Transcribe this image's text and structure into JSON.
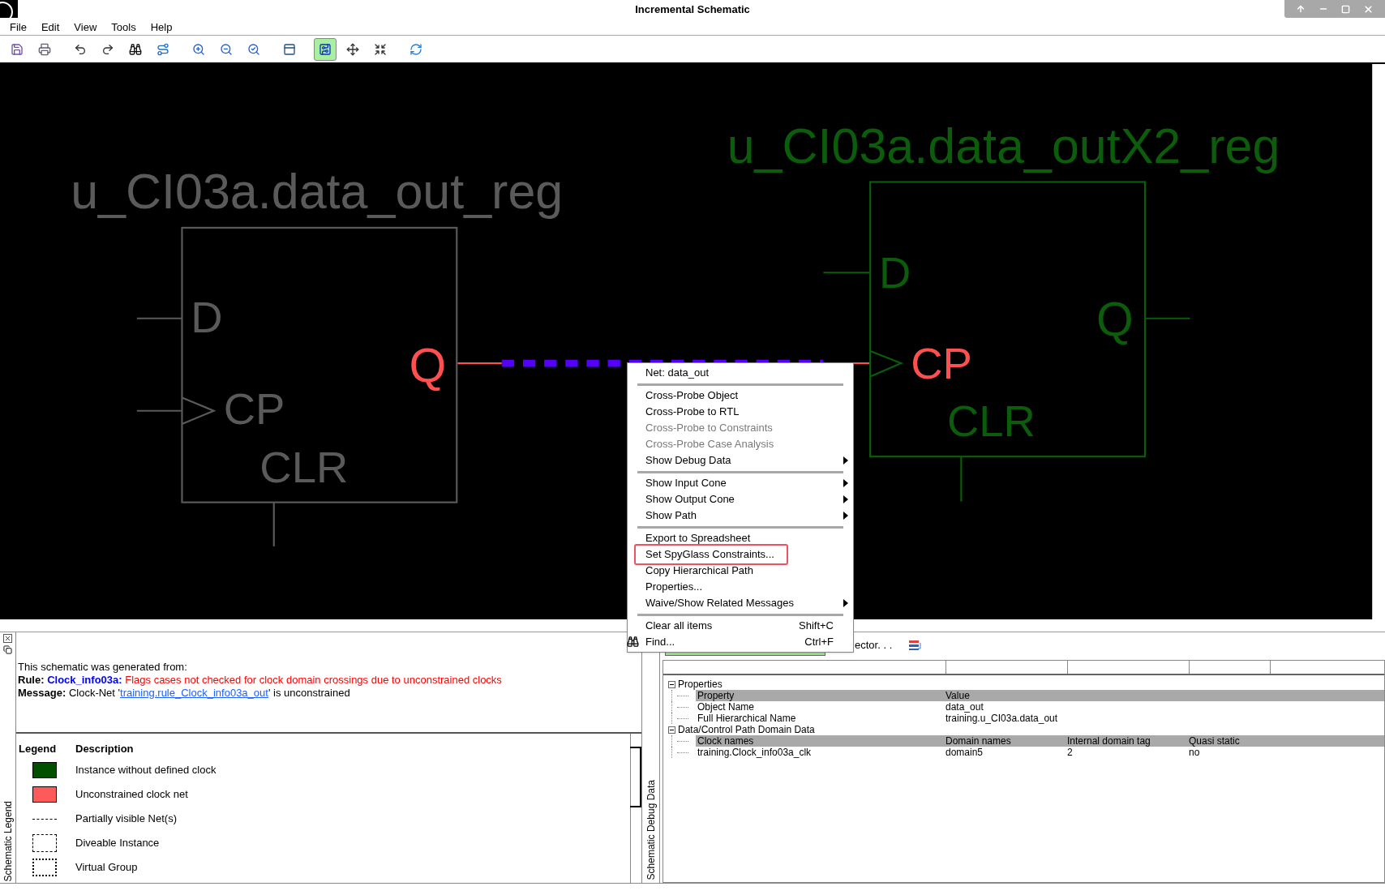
{
  "window": {
    "title": "Incremental Schematic"
  },
  "menu_bar": [
    {
      "label": "File"
    },
    {
      "label": "Edit"
    },
    {
      "label": "View"
    },
    {
      "label": "Tools"
    },
    {
      "label": "Help"
    }
  ],
  "toolbar": [
    {
      "buttons": [
        {
          "kind": "save",
          "selected": false
        },
        {
          "kind": "print",
          "selected": false
        }
      ]
    },
    {
      "buttons": [
        {
          "kind": "undo",
          "selected": false
        },
        {
          "kind": "redo",
          "selected": false
        },
        {
          "kind": "find",
          "selected": false
        },
        {
          "kind": "route",
          "selected": false
        }
      ]
    },
    {
      "buttons": [
        {
          "kind": "zoom-in",
          "selected": false
        },
        {
          "kind": "zoom-out",
          "selected": false
        },
        {
          "kind": "zoom-fit",
          "selected": false
        }
      ]
    },
    {
      "buttons": [
        {
          "kind": "panel",
          "selected": false
        }
      ]
    },
    {
      "buttons": [
        {
          "kind": "circuit",
          "selected": true
        },
        {
          "kind": "expand",
          "selected": false
        },
        {
          "kind": "contract",
          "selected": false
        }
      ]
    },
    {
      "buttons": [
        {
          "kind": "refresh",
          "selected": false
        }
      ]
    }
  ],
  "schematic": {
    "instances": [
      {
        "name": "u_CI03a.data_out_reg",
        "color": "#5a5a5a",
        "pins": [
          {
            "label": "D",
            "color": "#5a5a5a"
          },
          {
            "label": "CP",
            "color": "#5a5a5a"
          },
          {
            "label": "CLR",
            "color": "#5a5a5a"
          },
          {
            "label": "Q",
            "color": "#ff5050"
          }
        ]
      },
      {
        "name": "u_CI03a.data_outX2_reg",
        "color": "#0b5c0b",
        "pins": [
          {
            "label": "D",
            "color": "#0b5c0b"
          },
          {
            "label": "CP",
            "color": "#ff5050"
          },
          {
            "label": "CLR",
            "color": "#0b5c0b"
          },
          {
            "label": "Q",
            "color": "#0b5c0b"
          }
        ]
      }
    ]
  },
  "context_menu": {
    "items": [
      {
        "kind": "header",
        "label": "Net: data_out"
      },
      {
        "kind": "separator"
      },
      {
        "kind": "item",
        "label": "Cross-Probe Object",
        "disabled": false,
        "submenu": false,
        "highlighted": false
      },
      {
        "kind": "item",
        "label": "Cross-Probe to RTL",
        "disabled": false,
        "submenu": false,
        "highlighted": false
      },
      {
        "kind": "item",
        "label": "Cross-Probe to Constraints",
        "disabled": true,
        "submenu": false,
        "highlighted": false
      },
      {
        "kind": "item",
        "label": "Cross-Probe Case Analysis",
        "disabled": true,
        "submenu": false,
        "highlighted": false
      },
      {
        "kind": "item",
        "label": "Show Debug Data",
        "disabled": false,
        "submenu": true,
        "highlighted": false
      },
      {
        "kind": "separator"
      },
      {
        "kind": "item",
        "label": "Show Input Cone",
        "disabled": false,
        "submenu": true,
        "highlighted": false
      },
      {
        "kind": "item",
        "label": "Show Output Cone",
        "disabled": false,
        "submenu": true,
        "highlighted": false
      },
      {
        "kind": "item",
        "label": "Show Path",
        "disabled": false,
        "submenu": true,
        "highlighted": false
      },
      {
        "kind": "separator"
      },
      {
        "kind": "item",
        "label": "Export to Spreadsheet",
        "disabled": false,
        "submenu": false,
        "highlighted": false
      },
      {
        "kind": "item",
        "label": "Set SpyGlass Constraints...",
        "disabled": false,
        "submenu": false,
        "highlighted": true
      },
      {
        "kind": "item",
        "label": "Copy Hierarchical Path",
        "disabled": false,
        "submenu": false,
        "highlighted": false
      },
      {
        "kind": "item",
        "label": "Properties...",
        "disabled": false,
        "submenu": false,
        "highlighted": false
      },
      {
        "kind": "item",
        "label": "Waive/Show Related Messages",
        "disabled": false,
        "submenu": true,
        "highlighted": false
      },
      {
        "kind": "separator"
      },
      {
        "kind": "item",
        "label": "Clear all items",
        "shortcut": "Shift+C",
        "disabled": false,
        "submenu": false,
        "highlighted": false
      },
      {
        "kind": "item",
        "label": "Find...",
        "shortcut": "Ctrl+F",
        "disabled": false,
        "submenu": false,
        "highlighted": false
      }
    ]
  },
  "legend_panel": {
    "tab": "Schematic Legend",
    "generated_from": "This schematic was generated from:",
    "rule": {
      "label": "Rule:",
      "name": "Clock_info03a:",
      "description": "Flags cases not checked for clock domain crossings due to unconstrained clocks"
    },
    "message": {
      "label": "Message:",
      "before": "Clock-Net '",
      "link": "training.rule_Clock_info03a_out",
      "after": "' is unconstrained"
    },
    "columns": [
      "Legend",
      "Description"
    ],
    "rows": [
      {
        "kind": "swatch",
        "color": "#005000",
        "description": "Instance without defined clock"
      },
      {
        "kind": "swatch",
        "color": "#ff5a5a",
        "description": "Unconstrained clock net"
      },
      {
        "kind": "dashed-line",
        "description": "Partially visible Net(s)"
      },
      {
        "kind": "dashdot-box",
        "description": "Diveable Instance"
      },
      {
        "kind": "dashed-box",
        "description": "Virtual Group"
      }
    ]
  },
  "debug_panel": {
    "tab": "Schematic Debug Data",
    "toolbar_text": "ector. . .",
    "tree": [
      {
        "label": "Properties",
        "expanded": true,
        "children": [
          {
            "kind": "header",
            "cells": [
              "Property",
              "Value"
            ]
          },
          {
            "kind": "row",
            "cells": [
              "Object Name",
              "data_out"
            ]
          },
          {
            "kind": "row",
            "cells": [
              "Full Hierarchical Name",
              "training.u_CI03a.data_out"
            ]
          }
        ]
      },
      {
        "label": "Data/Control Path Domain Data",
        "expanded": true,
        "children": [
          {
            "kind": "header",
            "cells": [
              "Clock names",
              "Domain names",
              "Internal domain tag",
              "Quasi static"
            ]
          },
          {
            "kind": "row",
            "cells": [
              "training.Clock_info03a_clk",
              "domain5",
              "2",
              "no"
            ]
          }
        ]
      }
    ]
  }
}
